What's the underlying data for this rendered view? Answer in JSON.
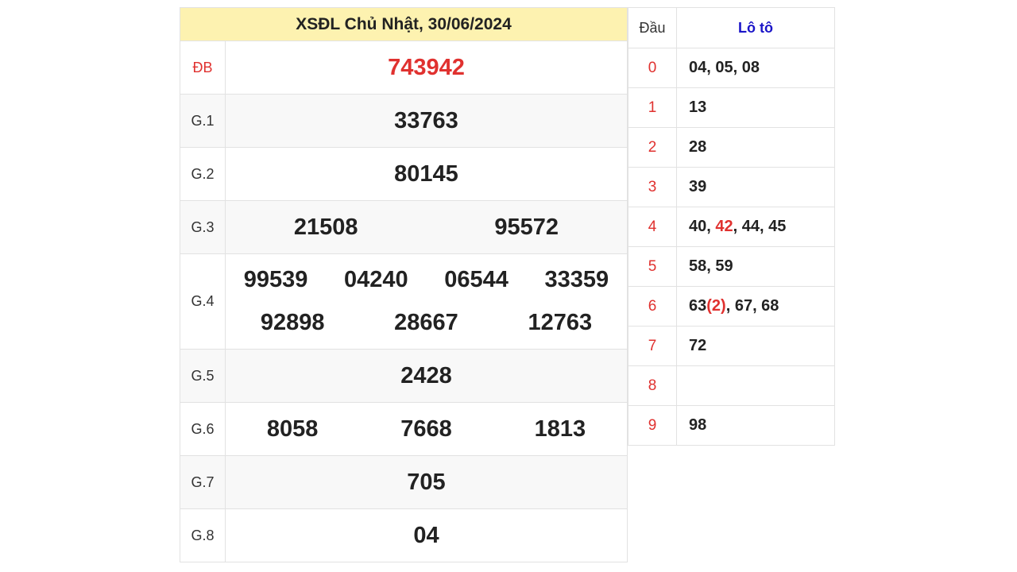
{
  "results": {
    "title": "XSĐL Chủ Nhật, 30/06/2024",
    "prizes": [
      {
        "label": "ĐB",
        "numbers": [
          "743942"
        ]
      },
      {
        "label": "G.1",
        "numbers": [
          "33763"
        ]
      },
      {
        "label": "G.2",
        "numbers": [
          "80145"
        ]
      },
      {
        "label": "G.3",
        "numbers": [
          "21508",
          "95572"
        ]
      },
      {
        "label": "G.4",
        "numbers": [
          "99539",
          "04240",
          "06544",
          "33359",
          "92898",
          "28667",
          "12763"
        ]
      },
      {
        "label": "G.5",
        "numbers": [
          "2428"
        ]
      },
      {
        "label": "G.6",
        "numbers": [
          "8058",
          "7668",
          "1813"
        ]
      },
      {
        "label": "G.7",
        "numbers": [
          "705"
        ]
      },
      {
        "label": "G.8",
        "numbers": [
          "04"
        ]
      }
    ]
  },
  "loto": {
    "header_dau": "Đầu",
    "header_loto": "Lô tô",
    "rows": [
      {
        "dau": "0",
        "parts": [
          {
            "t": "04, 05, 08"
          }
        ]
      },
      {
        "dau": "1",
        "parts": [
          {
            "t": "13"
          }
        ]
      },
      {
        "dau": "2",
        "parts": [
          {
            "t": "28"
          }
        ]
      },
      {
        "dau": "3",
        "parts": [
          {
            "t": "39"
          }
        ]
      },
      {
        "dau": "4",
        "parts": [
          {
            "t": "40, "
          },
          {
            "t": "42",
            "hl": true
          },
          {
            "t": ", 44, 45"
          }
        ]
      },
      {
        "dau": "5",
        "parts": [
          {
            "t": "58, 59"
          }
        ]
      },
      {
        "dau": "6",
        "parts": [
          {
            "t": "63"
          },
          {
            "t": "(2)",
            "hl": true
          },
          {
            "t": ", 67, 68"
          }
        ]
      },
      {
        "dau": "7",
        "parts": [
          {
            "t": "72"
          }
        ]
      },
      {
        "dau": "8",
        "parts": []
      },
      {
        "dau": "9",
        "parts": [
          {
            "t": "98"
          }
        ]
      }
    ]
  },
  "colors": {
    "accent_red": "#e0312f",
    "header_yellow": "#fdf2b0",
    "loto_blue": "#1a14c8"
  }
}
